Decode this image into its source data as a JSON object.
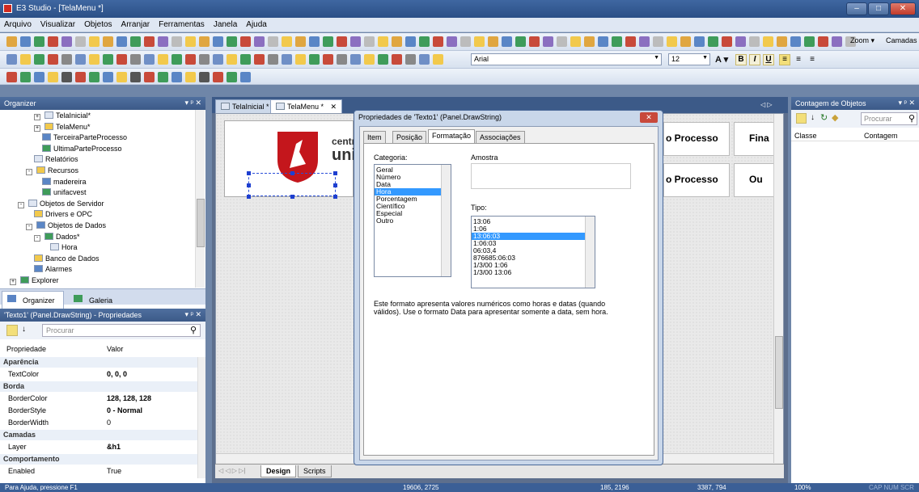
{
  "window": {
    "title": "E3 Studio - [TelaMenu *]"
  },
  "menu": [
    "Arquivo",
    "Visualizar",
    "Objetos",
    "Arranjar",
    "Ferramentas",
    "Janela",
    "Ajuda"
  ],
  "toolbar": {
    "font": "Arial",
    "font_size": "12",
    "bold": "B",
    "italic": "I",
    "underline": "U",
    "zoom": "Zoom",
    "camadas": "Camadas"
  },
  "organizer": {
    "title": "Organizer",
    "tree": [
      {
        "label": "TelaInicial*",
        "indent": 3,
        "expander": "+"
      },
      {
        "label": "TelaMenu*",
        "indent": 3,
        "expander": "+"
      },
      {
        "label": "TerceiraParteProcesso",
        "indent": 4,
        "expander": ""
      },
      {
        "label": "UltimaParteProcesso",
        "indent": 4,
        "expander": ""
      },
      {
        "label": "Relatórios",
        "indent": 3,
        "expander": ""
      },
      {
        "label": "Recursos",
        "indent": 2,
        "expander": "-"
      },
      {
        "label": "madereira",
        "indent": 4,
        "expander": ""
      },
      {
        "label": "unifacvest",
        "indent": 4,
        "expander": ""
      },
      {
        "label": "Objetos de Servidor",
        "indent": 1,
        "expander": "-"
      },
      {
        "label": "Drivers e OPC",
        "indent": 3,
        "expander": ""
      },
      {
        "label": "Objetos de Dados",
        "indent": 2,
        "expander": "-"
      },
      {
        "label": "Dados*",
        "indent": 3,
        "expander": "-"
      },
      {
        "label": "Hora",
        "indent": 5,
        "expander": ""
      },
      {
        "label": "Banco de Dados",
        "indent": 3,
        "expander": ""
      },
      {
        "label": "Alarmes",
        "indent": 3,
        "expander": ""
      },
      {
        "label": "Explorer",
        "indent": 0,
        "expander": "+"
      }
    ],
    "tabs": [
      "Organizer",
      "Galeria"
    ]
  },
  "properties": {
    "title": "'Texto1' (Panel.DrawString) - Propriedades",
    "search_placeholder": "Procurar",
    "col_prop": "Propriedade",
    "col_value": "Valor",
    "rows": [
      {
        "kind": "cat",
        "name": "Aparência",
        "value": ""
      },
      {
        "kind": "prop",
        "name": "TextColor",
        "value": "0, 0, 0"
      },
      {
        "kind": "cat",
        "name": "Borda",
        "value": ""
      },
      {
        "kind": "prop",
        "name": "BorderColor",
        "value": "128, 128, 128"
      },
      {
        "kind": "prop",
        "name": "BorderStyle",
        "value": "0 - Normal"
      },
      {
        "kind": "prop",
        "name": "BorderWidth",
        "value": "0"
      },
      {
        "kind": "cat",
        "name": "Camadas",
        "value": ""
      },
      {
        "kind": "prop",
        "name": "Layer",
        "value": "&h1"
      },
      {
        "kind": "cat",
        "name": "Comportamento",
        "value": ""
      },
      {
        "kind": "prop",
        "name": "Enabled",
        "value": "True"
      }
    ]
  },
  "doc_tabs": [
    "TelaInicial *",
    "TelaMenu *"
  ],
  "canvas": {
    "logo_text1": "centro",
    "logo_text2": "uni",
    "btn1": "o Processo",
    "btn2": "Fina",
    "btn3": "o Processo",
    "btn4": "Ou",
    "bottom_tabs": [
      "Design",
      "Scripts"
    ]
  },
  "right_panel": {
    "title": "Contagem de Objetos",
    "search_placeholder": "Procurar",
    "col1": "Classe",
    "col2": "Contagem"
  },
  "dialog": {
    "title": "Propriedades de 'Texto1' (Panel.DrawString)",
    "tabs": [
      "Item",
      "Posição",
      "Formatação",
      "Associações"
    ],
    "category_label": "Categoria:",
    "categories": [
      "Geral",
      "Número",
      "Data",
      "Hora",
      "Porcentagem",
      "Científico",
      "Especial",
      "Outro"
    ],
    "selected_category": 3,
    "sample_label": "Amostra",
    "type_label": "Tipo:",
    "types": [
      "13:06",
      "1:06",
      "13:06:03",
      "1:06:03",
      "06:03,4",
      "876685:06:03",
      "1/3/00 1:06",
      "1/3/00 13:06"
    ],
    "selected_type": 2,
    "description": "Este formato apresenta valores numéricos como horas e datas (quando válidos). Use o formato Data para apresentar somente a data, sem hora."
  },
  "status": {
    "help": "Para Ajuda, pressione F1",
    "pos": "19606, 2725",
    "size": "185, 2196",
    "size2": "3387, 794",
    "zoom": "100%",
    "keys": "CAP NUM SCR"
  }
}
